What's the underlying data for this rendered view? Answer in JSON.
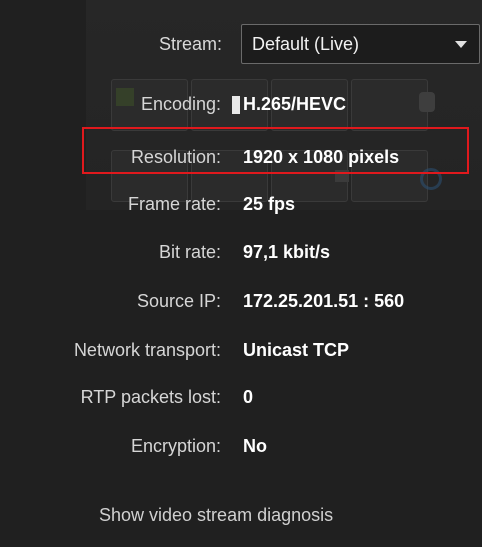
{
  "stream": {
    "label": "Stream:",
    "selected": "Default (Live)"
  },
  "properties": {
    "encoding": {
      "label": "Encoding:",
      "value": "H.265/HEVC"
    },
    "resolution": {
      "label": "Resolution:",
      "value": "1920 x 1080 pixels"
    },
    "frame_rate": {
      "label": "Frame rate:",
      "value": "25 fps"
    },
    "bit_rate": {
      "label": "Bit rate:",
      "value": "97,1 kbit/s"
    },
    "source_ip": {
      "label": "Source IP:",
      "value": "172.25.201.51 : 560"
    },
    "network_transport": {
      "label": "Network transport:",
      "value": "Unicast TCP"
    },
    "rtp_packets_lost": {
      "label": "RTP packets lost:",
      "value": "0"
    },
    "encryption": {
      "label": "Encryption:",
      "value": "No"
    }
  },
  "diagnosis_link": "Show video stream diagnosis",
  "colors": {
    "panel_background": "#202020",
    "highlight": "#e0191d"
  }
}
